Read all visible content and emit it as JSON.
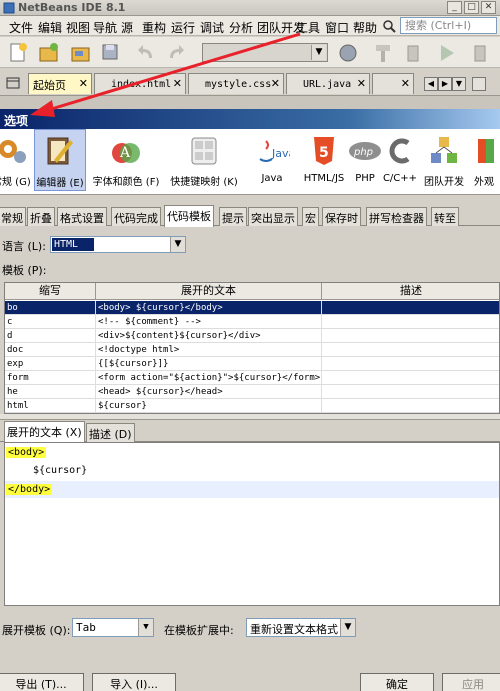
{
  "window": {
    "title": "NetBeans IDE 8.1"
  },
  "menu": [
    "文件",
    "编辑",
    "视图",
    "导航",
    "源",
    "重构",
    "运行",
    "调试",
    "分析",
    "团队开发",
    "工具",
    "窗口",
    "帮助"
  ],
  "search": {
    "placeholder": "搜索 (Ctrl+I)"
  },
  "editor_tabs": [
    {
      "label": "起始页"
    },
    {
      "label": "index.html"
    },
    {
      "label": "mystyle.css"
    },
    {
      "label": "URL.java"
    }
  ],
  "dialog": {
    "title": "选项"
  },
  "categories": [
    {
      "label": "常规 (G)",
      "icon": "gear-icon"
    },
    {
      "label": "编辑器 (E)",
      "icon": "editor-icon",
      "selected": true
    },
    {
      "label": "字体和颜色 (F)",
      "icon": "fonts-colors-icon"
    },
    {
      "label": "快捷键映射 (K)",
      "icon": "keyboard-icon"
    },
    {
      "label": "Java",
      "icon": "java-icon"
    },
    {
      "label": "HTML/JS",
      "icon": "html5-icon"
    },
    {
      "label": "PHP",
      "icon": "php-icon"
    },
    {
      "label": "C/C++",
      "icon": "cpp-icon"
    },
    {
      "label": "团队开发",
      "icon": "team-icon"
    },
    {
      "label": "外观",
      "icon": "appearance-icon"
    }
  ],
  "sub_tabs": [
    "常规",
    "折叠",
    "格式设置",
    "代码完成",
    "代码模板",
    "提示",
    "突出显示",
    "宏",
    "保存时",
    "拼写检查器",
    "转至"
  ],
  "language": {
    "label": "语言 (L):",
    "value": "HTML"
  },
  "templates": {
    "label": "模板 (P):",
    "columns": [
      "缩写",
      "展开的文本",
      "描述"
    ],
    "rows": [
      {
        "abbr": "bo",
        "text": "<body>    ${cursor}</body>",
        "desc": ""
      },
      {
        "abbr": "c",
        "text": "<!-- ${comment} -->",
        "desc": ""
      },
      {
        "abbr": "d",
        "text": "<div>${content}${cursor}</div>",
        "desc": ""
      },
      {
        "abbr": "doc",
        "text": "<!doctype html>",
        "desc": ""
      },
      {
        "abbr": "exp",
        "text": "{[${cursor}]}",
        "desc": ""
      },
      {
        "abbr": "form",
        "text": "<form action=\"${action}\">${cursor}</form>",
        "desc": ""
      },
      {
        "abbr": "he",
        "text": "<head>    ${cursor}</head>",
        "desc": ""
      },
      {
        "abbr": "html",
        "text": "${cursor}",
        "desc": ""
      }
    ]
  },
  "bottom_tabs": [
    "展开的文本 (X)",
    "描述 (D)"
  ],
  "code": {
    "line1": "<body>",
    "line2": "${cursor}",
    "line3": "</body>"
  },
  "options_row": {
    "expand_label": "展开模板 (Q):",
    "expand_value": "Tab",
    "on_expand_label": "在模板扩展中:",
    "on_expand_value": "重新设置文本格式"
  },
  "footer": {
    "export": "导出 (T)...",
    "import": "导入 (I)...",
    "ok": "确定",
    "apply": "应用"
  },
  "colors": {
    "selection": "#0a246a",
    "title_gradient_start": "#0a246a",
    "accent_arrow": "#e8212b"
  }
}
